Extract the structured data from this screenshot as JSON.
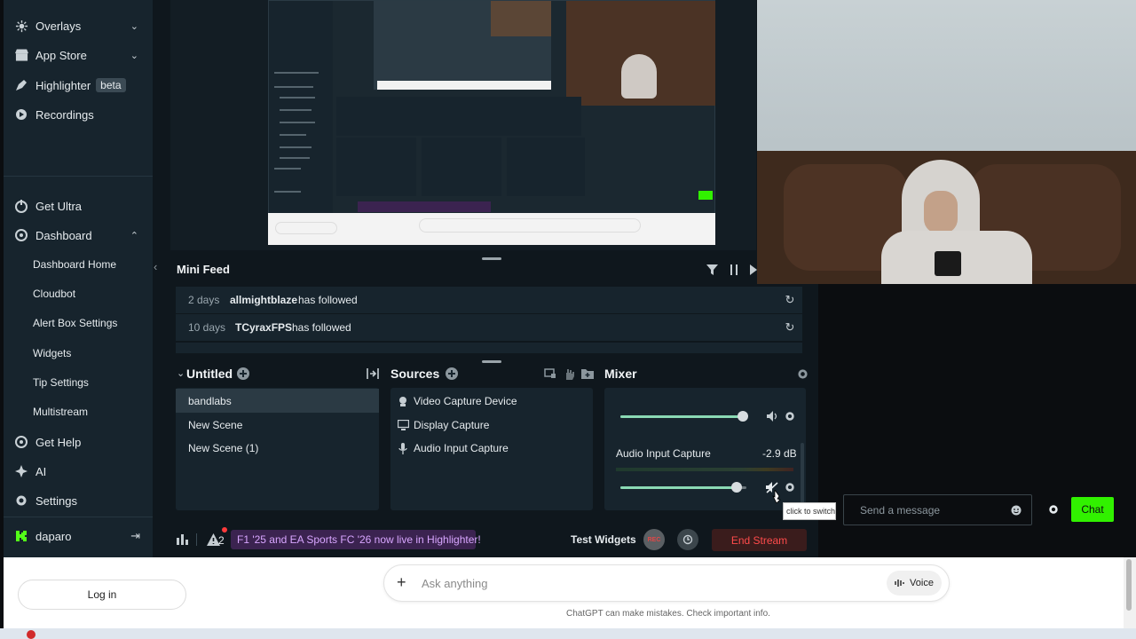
{
  "sidebar": {
    "items": [
      {
        "label": "Overlays",
        "icon": "overlays-icon"
      },
      {
        "label": "App Store",
        "icon": "store-icon"
      },
      {
        "label": "Highlighter",
        "icon": "highlighter-icon",
        "badge": "beta"
      },
      {
        "label": "Recordings",
        "icon": "recordings-icon"
      },
      {
        "label": "Get Ultra",
        "icon": "ultra-icon"
      },
      {
        "label": "Dashboard",
        "icon": "dashboard-icon"
      },
      {
        "label": "Get Help",
        "icon": "help-icon"
      },
      {
        "label": "AI",
        "icon": "ai-icon"
      },
      {
        "label": "Settings",
        "icon": "settings-icon"
      }
    ],
    "dashboard_sub": [
      "Dashboard Home",
      "Cloudbot",
      "Alert Box Settings",
      "Widgets",
      "Tip Settings",
      "Multistream"
    ],
    "user": "daparo"
  },
  "minifeed": {
    "title": "Mini Feed",
    "rows": [
      {
        "time": "2 days",
        "user": "allmightblaze",
        "action": "has followed"
      },
      {
        "time": "10 days",
        "user": "TCyraxFPS",
        "action": "has followed"
      }
    ]
  },
  "scenes": {
    "title": "Untitled",
    "items": [
      "bandlabs",
      "New Scene",
      "New Scene (1)"
    ]
  },
  "sources": {
    "title": "Sources",
    "items": [
      {
        "label": "Video Capture Device",
        "icon": "camera-icon"
      },
      {
        "label": "Display Capture",
        "icon": "monitor-icon"
      },
      {
        "label": "Audio Input Capture",
        "icon": "microphone-icon"
      }
    ]
  },
  "mixer": {
    "title": "Mixer",
    "channel1_level": 0.97,
    "channel2_name": "Audio Input Capture",
    "channel2_db": "-2.9 dB",
    "channel2_level": 0.92,
    "tooltip": "click to switch on"
  },
  "footer": {
    "alerts_count": "2",
    "banner": "F1 '25 and EA Sports FC '26 now live in Highlighter!",
    "test_widgets": "Test Widgets",
    "rec": "REC",
    "end_stream": "End Stream"
  },
  "chat": {
    "placeholder": "Send a message",
    "send": "Chat"
  },
  "gpt": {
    "login": "Log in",
    "placeholder": "Ask anything",
    "voice": "Voice",
    "disclaimer": "ChatGPT can make mistakes. Check important info."
  },
  "colors": {
    "accent_green": "#31f100",
    "banner_purple": "#3b2350",
    "banner_text": "#d8a6ff",
    "end_stream_bg": "#3a1c1c",
    "end_stream_text": "#ff4b4b"
  }
}
